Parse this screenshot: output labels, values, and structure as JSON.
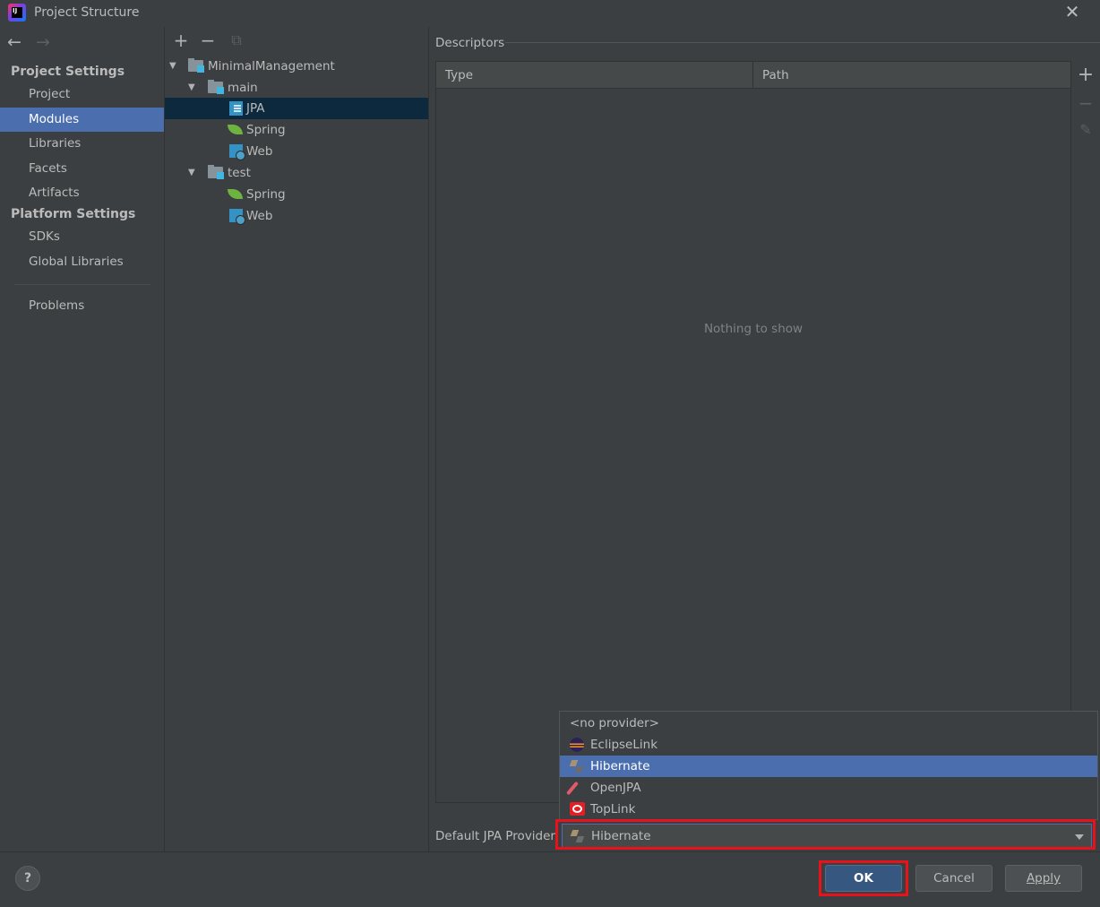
{
  "window": {
    "title": "Project Structure"
  },
  "nav": {
    "back": "←",
    "forward": "→"
  },
  "left_panel": {
    "sections": [
      {
        "header": "Project Settings",
        "items": [
          "Project",
          "Modules",
          "Libraries",
          "Facets",
          "Artifacts"
        ]
      },
      {
        "header": "Platform Settings",
        "items": [
          "SDKs",
          "Global Libraries"
        ]
      }
    ],
    "problems": "Problems",
    "selected": "Modules"
  },
  "tree_toolbar": {
    "add": "+",
    "remove": "−",
    "copy": "⧉"
  },
  "tree": {
    "root": "MinimalManagement",
    "main": "main",
    "main_jpa": "JPA",
    "main_spring": "Spring",
    "main_web": "Web",
    "test": "test",
    "test_spring": "Spring",
    "test_web": "Web",
    "selected": "JPA"
  },
  "descriptors": {
    "title": "Descriptors",
    "columns": [
      "Type",
      "Path"
    ],
    "empty_text": "Nothing to show",
    "add": "+",
    "remove": "−",
    "edit": "✎"
  },
  "provider": {
    "label": "Default JPA Provider",
    "selected": "Hibernate",
    "options": [
      "<no provider>",
      "EclipseLink",
      "Hibernate",
      "OpenJPA",
      "TopLink"
    ]
  },
  "buttons": {
    "help": "?",
    "ok": "OK",
    "cancel": "Cancel",
    "apply": "Apply"
  },
  "colors": {
    "background": "#3c3f41",
    "selection": "#4b6eaf",
    "tree_selection": "#0d293e",
    "highlight": "#e8121b"
  }
}
